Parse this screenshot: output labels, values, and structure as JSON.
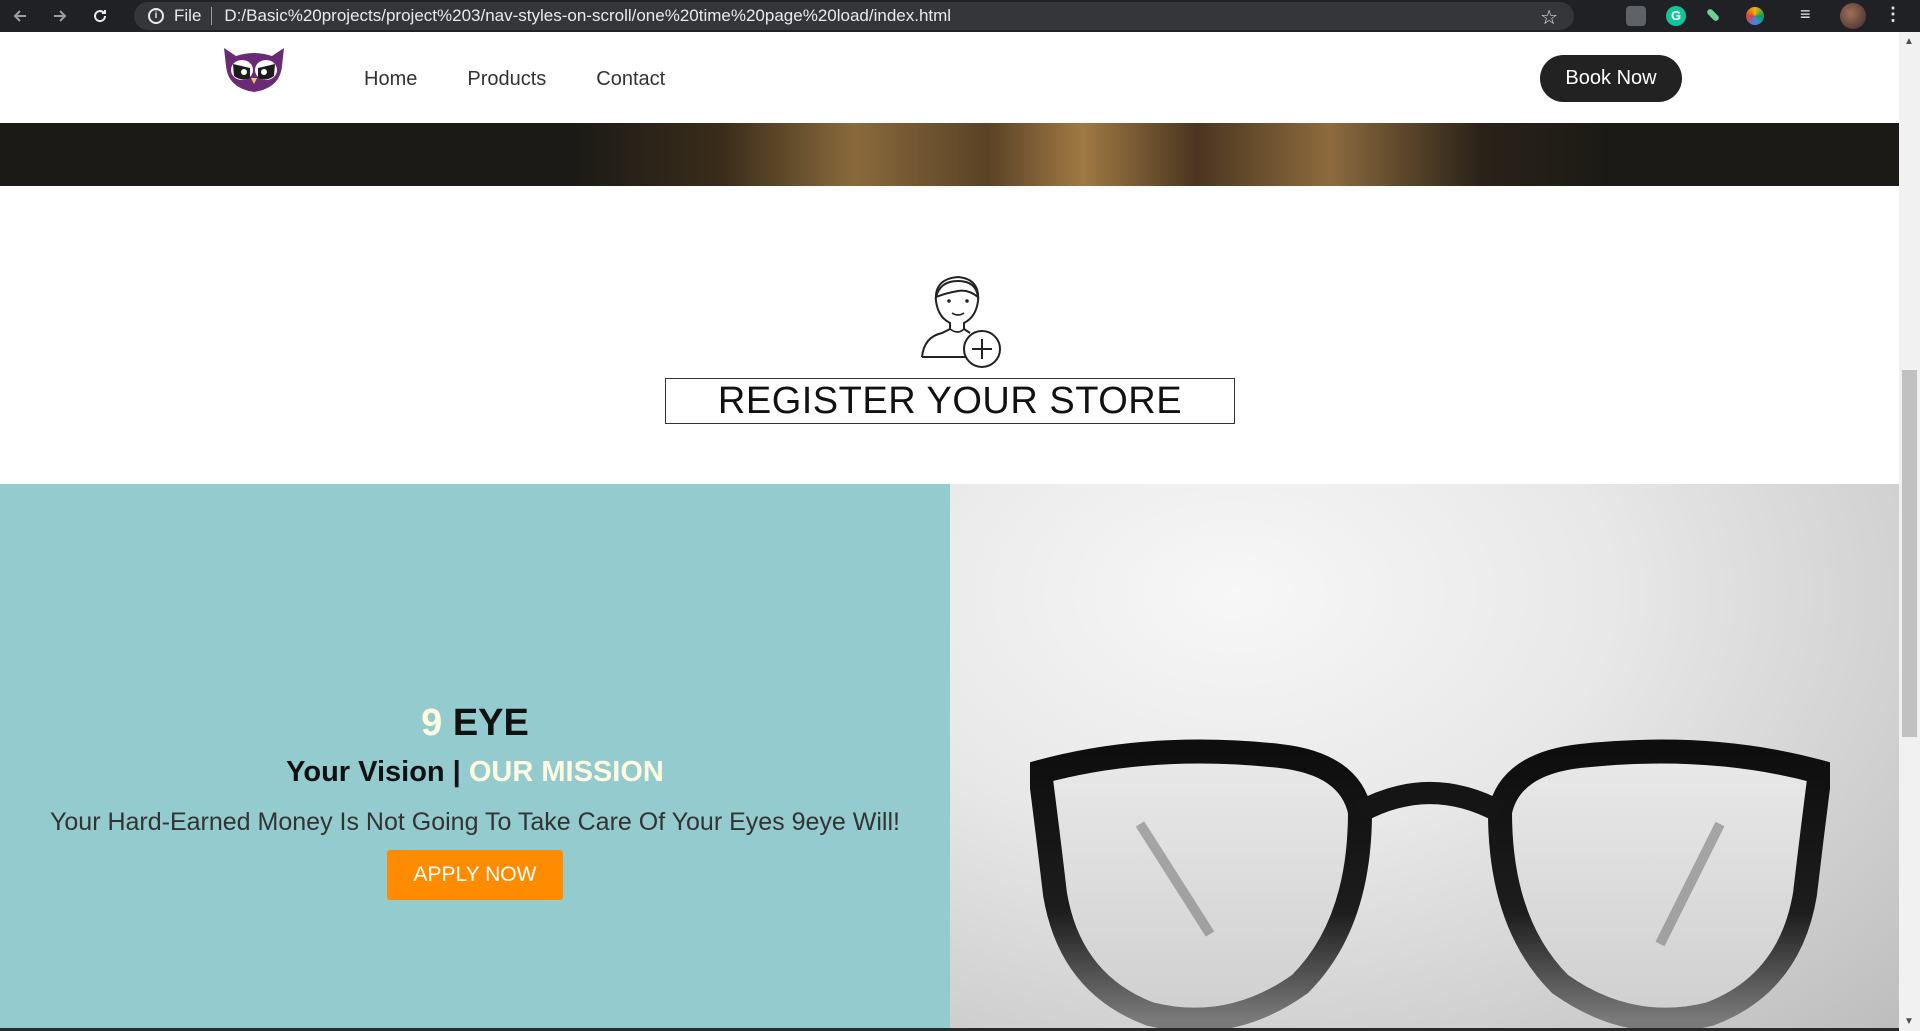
{
  "browser": {
    "scheme": "File",
    "url": "D:/Basic%20projects/project%203/nav-styles-on-scroll/one%20time%20page%20load/index.html",
    "extension_g": "G"
  },
  "navbar": {
    "links": [
      "Home",
      "Products",
      "Contact"
    ],
    "book_label": "Book Now",
    "logo_color": "#6b2a75"
  },
  "register": {
    "label": "REGISTER YOUR STORE"
  },
  "mission": {
    "brand_num": "9",
    "brand_name": " EYE",
    "vision": "Your Vision | ",
    "mission_word": "OUR MISSION",
    "description": "Your Hard-Earned Money Is Not Going To Take Care Of Your Eyes 9eye Will!",
    "apply_label": "APPLY NOW",
    "panel_color": "#93cbcf",
    "accent_color": "#ff8c00"
  }
}
